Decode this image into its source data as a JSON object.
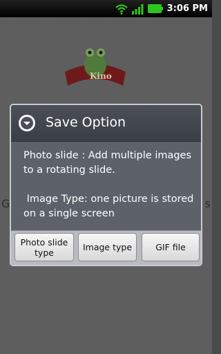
{
  "status_bar": {
    "time": "3:06 PM",
    "icons": [
      "wifi-icon",
      "signal-icon",
      "battery-icon"
    ],
    "accent_color": "#31c41f"
  },
  "background": {
    "logo_text": "Kino",
    "left_fragment": "G",
    "right_fragment": "s"
  },
  "dialog": {
    "icon": "chevron-down-circle-icon",
    "title": "Save Option",
    "message": "Photo slide : Add multiple images to a rotating slide.\n\n Image Type: one picture is stored on a single screen",
    "buttons": {
      "photo_slide": "Photo slide type",
      "image_type": "Image type",
      "gif_file": "GIF file"
    }
  }
}
